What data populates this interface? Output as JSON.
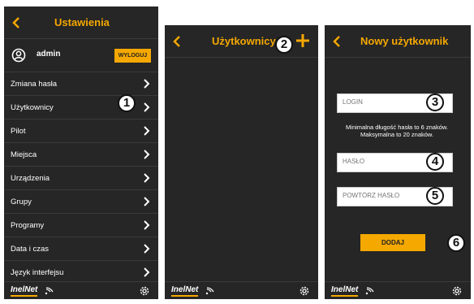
{
  "screen1": {
    "title": "Ustawienia",
    "user": {
      "name": "admin",
      "logout_label": "WYLOGUJ"
    },
    "menu": [
      {
        "label": "Zmiana hasła"
      },
      {
        "label": "Użytkownicy"
      },
      {
        "label": "Pilot"
      },
      {
        "label": "Miejsca"
      },
      {
        "label": "Urządzenia"
      },
      {
        "label": "Grupy"
      },
      {
        "label": "Programy"
      },
      {
        "label": "Data i czas"
      },
      {
        "label": "Język interfejsu"
      }
    ],
    "footer": {
      "brand": "InelNet"
    }
  },
  "screen2": {
    "title": "Użytkownicy",
    "footer": {
      "brand": "InelNet"
    }
  },
  "screen3": {
    "title": "Nowy użytkownik",
    "login_placeholder": "LOGIN",
    "password_note_1": "Minimalna długość hasła to 6 znaków.",
    "password_note_2": "Maksymalna to 20 znaków.",
    "password_placeholder": "HASŁO",
    "repeat_placeholder": "POWTÓRZ HASŁO",
    "add_label": "DODAJ",
    "footer": {
      "brand": "InelNet"
    }
  },
  "badges": [
    "1",
    "2",
    "3",
    "4",
    "5",
    "6"
  ],
  "colors": {
    "accent": "#f5a800",
    "panel": "#262626",
    "text": "#ffffff"
  },
  "icons": [
    "back-arrow-icon",
    "user-circle-icon",
    "chevron-right-icon",
    "wifi-icon",
    "gear-icon",
    "plus-icon"
  ]
}
